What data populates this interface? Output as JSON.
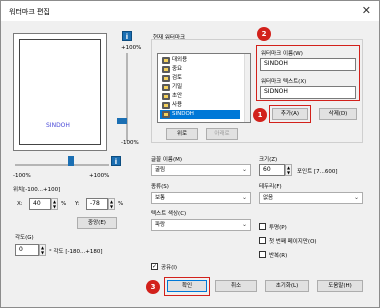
{
  "window": {
    "title": "워터마크 편집",
    "close_glyph": "✕"
  },
  "preview": {
    "text": "SINDOH",
    "color": "#4a4ad8"
  },
  "vslider": {
    "top_label": "+100%",
    "bottom_label": "-100%",
    "value_fraction": 0.5
  },
  "hslider": {
    "left_label": "-100%",
    "right_label": "+100%",
    "value_fraction": 0.5
  },
  "position": {
    "label": "위치[-100...+100]",
    "x_label": "X:",
    "x_value": "40",
    "x_unit": "%",
    "y_label": "Y:",
    "y_value": "-78",
    "y_unit": "%",
    "center_button": "중앙(E)"
  },
  "angle": {
    "label": "각도(G)",
    "value": "0",
    "range_label": "° 각도 [-180...+180]"
  },
  "current_list": {
    "label": "현재 워터마크",
    "items": [
      "대외용",
      "중요",
      "검토",
      "기밀",
      "초안",
      "사용",
      "SINDOH"
    ],
    "selected_index": 6
  },
  "list_buttons": {
    "up": "위로",
    "down": "아래로"
  },
  "name_field": {
    "label": "워터마크 이름(W)",
    "value": "SINDOH"
  },
  "text_field": {
    "label": "워터마크 텍스트(X)",
    "value": "SIDNOH"
  },
  "actions": {
    "add": "추가(A)",
    "delete": "삭제(D)"
  },
  "font_name": {
    "label": "글꼴 이름(M)",
    "value": "굴림"
  },
  "size": {
    "label": "크기(Z)",
    "value": "60",
    "unit": "포인트 [7...600]"
  },
  "style": {
    "label": "종류(S)",
    "value": "보통"
  },
  "border": {
    "label": "테두리(F)",
    "value": "없음"
  },
  "text_color": {
    "label": "텍스트 색상(C)",
    "value": "파랑"
  },
  "checkboxes": {
    "transparent": {
      "label": "투명(P)",
      "checked": false
    },
    "first_page_only": {
      "label": "첫 번째 페이지만(O)",
      "checked": false
    },
    "repeat": {
      "label": "반복(R)",
      "checked": false
    },
    "shared": {
      "label": "공유(I)",
      "checked": true
    }
  },
  "footer": {
    "ok": "확인",
    "cancel": "취소",
    "reset": "초기화(L)",
    "help": "도움말(H)"
  },
  "markers": {
    "one": "1",
    "two": "2",
    "three": "3"
  },
  "icons": {
    "info_glyph": "i",
    "dropdown_glyph": "⌄",
    "up_glyph": "▲",
    "down_glyph": "▼",
    "check_glyph": "✓"
  },
  "colors": {
    "accent": "#d2211b",
    "selection": "#0078d7",
    "slider": "#1b6fb3"
  }
}
